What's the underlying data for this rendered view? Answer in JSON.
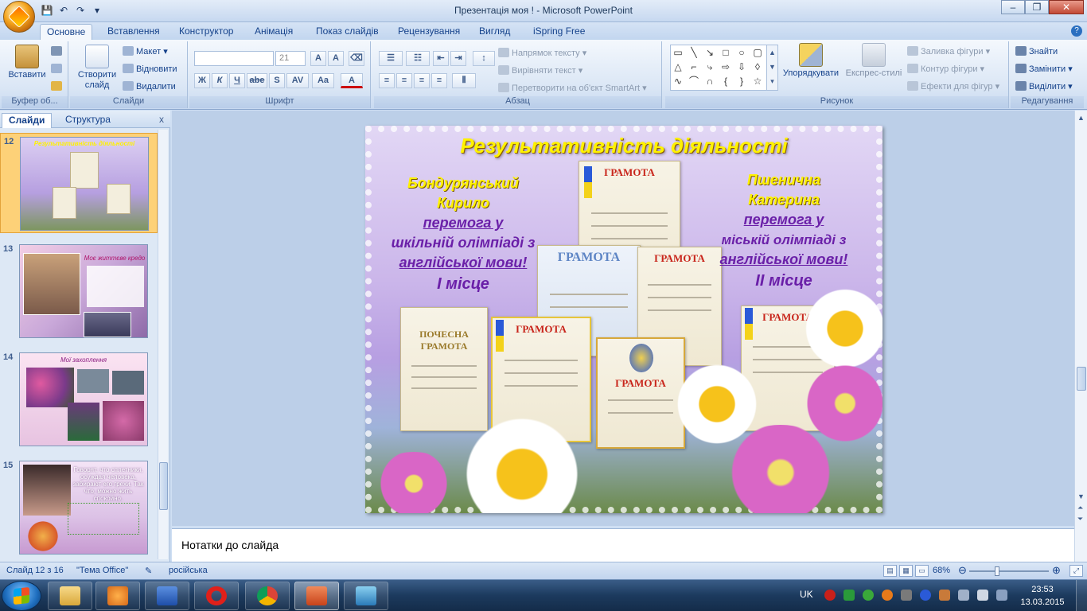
{
  "window": {
    "title": "Презентація моя ! - Microsoft PowerPoint"
  },
  "qat": {
    "save": "💾",
    "undo": "↶",
    "redo": "↷",
    "more": "▾"
  },
  "tabs": [
    "Основне",
    "Вставлення",
    "Конструктор",
    "Анімація",
    "Показ слайдів",
    "Рецензування",
    "Вигляд",
    "iSpring Free"
  ],
  "ribbon": {
    "clipboard": {
      "paste": "Вставити",
      "label": "Буфер об..."
    },
    "slides": {
      "new_slide": "Створити слайд",
      "layout": "Макет",
      "reset": "Відновити",
      "delete": "Видалити",
      "label": "Слайди"
    },
    "font": {
      "size": "21",
      "bold": "Ж",
      "italic": "К",
      "underline": "Ч",
      "strike": "abe",
      "shadow": "S",
      "spacing": "AV",
      "case": "Aa",
      "color": "A",
      "grow": "A",
      "shrink": "A",
      "label": "Шрифт"
    },
    "paragraph": {
      "text_dir": "Напрямок тексту",
      "align_text": "Вирівняти текст",
      "smartart": "Перетворити на об'єкт SmartArt",
      "label": "Абзац"
    },
    "drawing": {
      "arrange": "Упорядкувати",
      "quick_styles": "Експрес-стилі",
      "fill": "Заливка фігури",
      "outline": "Контур фігури",
      "effects": "Ефекти для фігур",
      "label": "Рисунок"
    },
    "editing": {
      "find": "Знайти",
      "replace": "Замінити",
      "select": "Виділити",
      "label": "Редагування"
    }
  },
  "leftpanel": {
    "tab_slides": "Слайди",
    "tab_outline": "Структура",
    "close": "x",
    "thumbs": [
      {
        "num": "12",
        "title": "Результативність діяльності"
      },
      {
        "num": "13",
        "title": "Моє життєве кредо"
      },
      {
        "num": "14",
        "title": "Мої захоплення"
      },
      {
        "num": "15",
        "title": "Говорят, что сплетники, осуждая человека, забирают его грехи. Так что, можно жить спокойно."
      }
    ]
  },
  "slide": {
    "title": "Результативність діяльності",
    "left": {
      "line1": "Бондурянський",
      "line2": "Кирило",
      "line3": "перемога у",
      "line4": "шкільній олімпіаді з",
      "line5": "англійської мови!",
      "line6": "І місце"
    },
    "right": {
      "line1": "Пшенична",
      "line2": "Катерина",
      "line3": "перемога у",
      "line4": "міській олімпіаді з",
      "line5": "англійської мови!",
      "line6": "ІІ місце"
    },
    "certificates": [
      "ГРАМОТА",
      "ГРАМОТА",
      "ГРАМОТА",
      "ПОЧЕСНА ГРАМОТА",
      "ГРАМОТА",
      "ГРАМОТА",
      "ГРАМОТА"
    ]
  },
  "notes": {
    "placeholder": "Нотатки до слайда"
  },
  "status": {
    "slide": "Слайд 12 з 16",
    "theme": "\"Тема Office\"",
    "lang": "російська",
    "zoom": "68%",
    "zoom_level": 0.34
  },
  "taskbar": {
    "lang": "UK",
    "time": "23:53",
    "date": "13.03.2015"
  },
  "colors": {
    "accent": "#15428b",
    "title_yellow": "#fff200",
    "text_purple": "#6a1fa8"
  }
}
